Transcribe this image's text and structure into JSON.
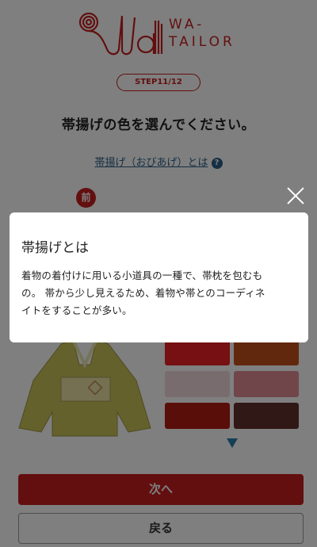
{
  "header": {
    "logo_text_line1": "WA-",
    "logo_text_line2": "TAILOR",
    "brand_color": "#c61e1e"
  },
  "step": {
    "label": "STEP11/12"
  },
  "question": {
    "text": "帯揚げの色を選んでください。"
  },
  "about_link": {
    "text": "帯揚げ（おびあげ）とは",
    "icon": "question-circle-icon"
  },
  "preview": {
    "front_label": "前"
  },
  "swatches": [
    {
      "color": "#ec2024"
    },
    {
      "color": "#c4501a"
    },
    {
      "color": "#f2d8dd"
    },
    {
      "color": "#e08d96"
    },
    {
      "color": "#b31c12"
    },
    {
      "color": "#60302e"
    }
  ],
  "buttons": {
    "next": "次へ",
    "back": "戻る"
  },
  "modal": {
    "title": "帯揚げとは",
    "body_line1": "着物の着付けに用いる小道具の一種で、帯枕を包むも",
    "body_line2": "の。 帯から少し見えるため、着物や帯とのコーディネ",
    "body_line3": "イトをすることが多い。",
    "close_icon": "close-icon"
  }
}
